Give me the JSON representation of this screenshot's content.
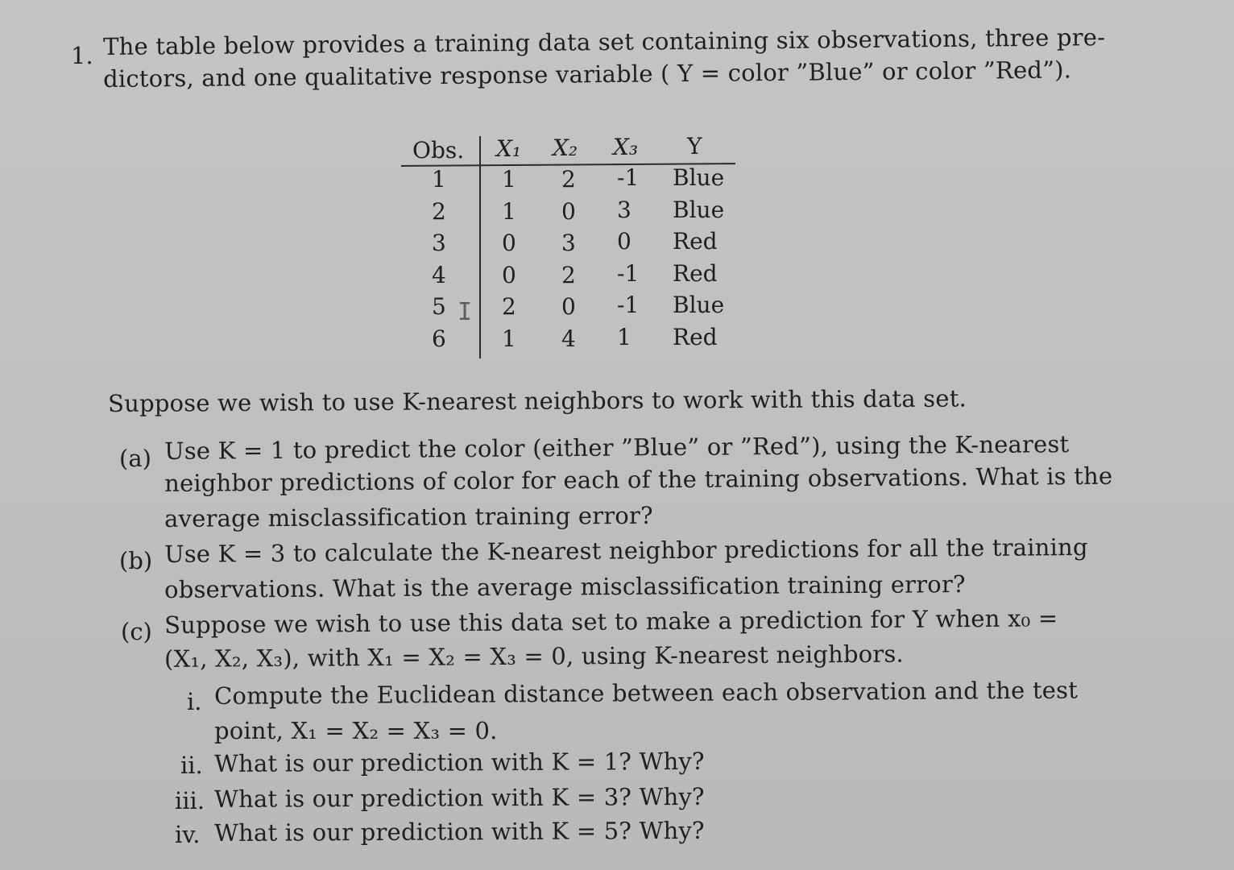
{
  "problem": {
    "number": "1.",
    "intro_line1": "The table below provides a training data set containing six observations, three pre-",
    "intro_line2_a": "dictors, and one qualitative response variable ( Y = color ”Blue” or color ”Red”)."
  },
  "table": {
    "headers": [
      "Obs.",
      "X₁",
      "X₂",
      "X₃",
      "Y"
    ],
    "rows": [
      {
        "obs": "1",
        "x1": "1",
        "x2": "2",
        "x3": "-1",
        "y": "Blue"
      },
      {
        "obs": "2",
        "x1": "1",
        "x2": "0",
        "x3": "3",
        "y": "Blue"
      },
      {
        "obs": "3",
        "x1": "0",
        "x2": "3",
        "x3": "0",
        "y": "Red"
      },
      {
        "obs": "4",
        "x1": "0",
        "x2": "2",
        "x3": "-1",
        "y": "Red"
      },
      {
        "obs": "5",
        "x1": "2",
        "x2": "0",
        "x3": "-1",
        "y": "Blue"
      },
      {
        "obs": "6",
        "x1": "1",
        "x2": "4",
        "x3": "1",
        "y": "Red"
      }
    ]
  },
  "cursor_glyph": "I",
  "lead": "Suppose we wish to use K-nearest neighbors to work with this data set.",
  "parts": {
    "a": {
      "label": "(a)",
      "line1": "Use K = 1 to predict the color (either ”Blue” or ”Red”), using the K-nearest",
      "line2": "neighbor predictions of color for each of the training observations. What is the",
      "line3": "average misclassification training error?"
    },
    "b": {
      "label": "(b)",
      "line1": "Use K = 3 to calculate the K-nearest neighbor predictions for all the training",
      "line2": "observations. What is the average misclassification training error?"
    },
    "c": {
      "label": "(c)",
      "line1": "Suppose we wish to use this data set to make a prediction for Y when x₀ =",
      "line2": "(X₁, X₂, X₃), with X₁ = X₂ = X₃ = 0, using K-nearest neighbors.",
      "subparts": [
        {
          "label": "i.",
          "line1": "Compute the Euclidean distance between each observation and the test",
          "line2": "point, X₁ = X₂ = X₃ = 0."
        },
        {
          "label": "ii.",
          "line1": "What is our prediction with K = 1? Why?"
        },
        {
          "label": "iii.",
          "line1": "What is our prediction with K = 3? Why?"
        },
        {
          "label": "iv.",
          "line1": "What is our prediction with K = 5? Why?"
        }
      ]
    }
  }
}
